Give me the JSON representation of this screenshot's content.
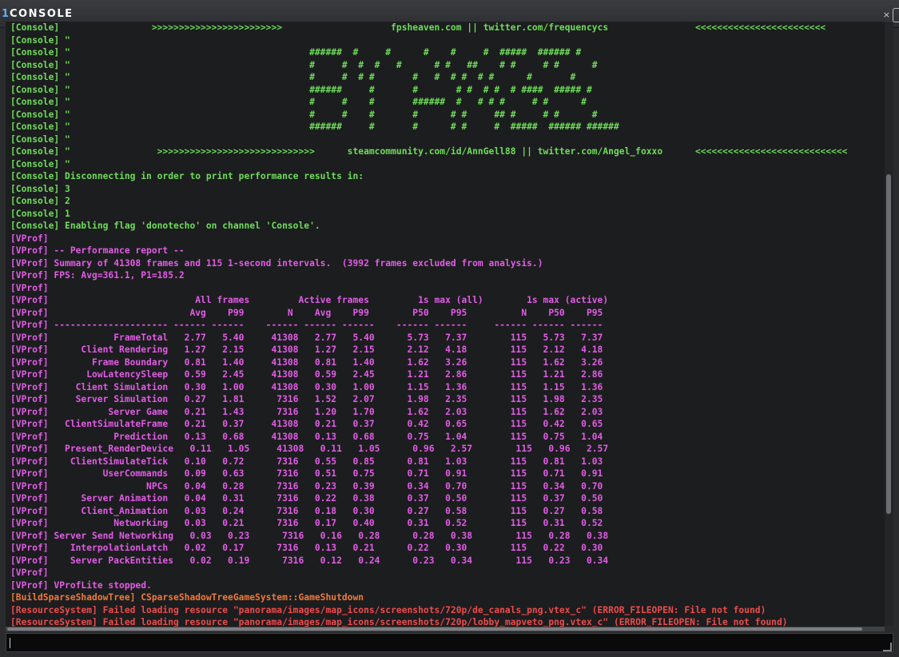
{
  "window": {
    "title_prefix": "1",
    "title": "CONSOLE",
    "close_glyph": "×"
  },
  "colors": {
    "console": "#6fdc5a",
    "vprof": "#e25ce6",
    "buildsparseshadowtree": "#ef7a3a",
    "resourcesystem": "#ee4b4b"
  },
  "log": [
    {
      "type": "console",
      "text": "[Console]                 >>>>>>>>>>>>>>>>>>>>>>>>                    fpsheaven.com || twitter.com/frequencycs                <<<<<<<<<<<<<<<<<<<<<<<<"
    },
    {
      "type": "console",
      "text": "[Console] \""
    },
    {
      "type": "console",
      "text": "[Console] \"                                            ######  #     #      #    #     #  #####  ###### #"
    },
    {
      "type": "console",
      "text": "[Console] \"                                            #     #  #  #   #      # #   ##    # #     # #      #"
    },
    {
      "type": "console",
      "text": "[Console] \"                                            #     #  # #       #   #  # #  # #      #       #"
    },
    {
      "type": "console",
      "text": "[Console] \"                                            ######     #       #       # #  # #  # ####  ##### #"
    },
    {
      "type": "console",
      "text": "[Console] \"                                            #     #    #       ######  #   # # #     # #      #"
    },
    {
      "type": "console",
      "text": "[Console] \"                                            #     #    #       #      # #     ## #     # #      #"
    },
    {
      "type": "console",
      "text": "[Console] \"                                            ######     #       #      # #     #  #####  ###### ######"
    },
    {
      "type": "console",
      "text": "[Console] \""
    },
    {
      "type": "console",
      "text": "[Console] \"                >>>>>>>>>>>>>>>>>>>>>>>>>>>>>      steamcommunity.com/id/AnnGell88 || twitter.com/Angel_foxxo      <<<<<<<<<<<<<<<<<<<<<<<<<<<<"
    },
    {
      "type": "console",
      "text": "[Console] \""
    },
    {
      "type": "console",
      "text": "[Console] Disconnecting in order to print performance results in:"
    },
    {
      "type": "console",
      "text": "[Console] 3"
    },
    {
      "type": "console",
      "text": "[Console] 2"
    },
    {
      "type": "console",
      "text": "[Console] 1"
    },
    {
      "type": "console",
      "text": "[Console] Enabling flag 'donotecho' on channel 'Console'."
    },
    {
      "type": "vprof",
      "text": "[VProf]"
    },
    {
      "type": "vprof",
      "text": "[VProf] -- Performance report --"
    },
    {
      "type": "vprof",
      "text": "[VProf] Summary of 41308 frames and 115 1-second intervals.  (3992 frames excluded from analysis.)"
    },
    {
      "type": "vprof",
      "text": "[VProf] FPS: Avg=361.1, P1=185.2"
    },
    {
      "type": "vprof",
      "text": "[VProf]"
    },
    {
      "type": "vprof",
      "text": "[VProf]                           All frames         Active frames         1s max (all)        1s max (active)"
    },
    {
      "type": "vprof",
      "text": "[VProf]                          Avg    P99        N    Avg    P99        P50    P95          N    P50    P95"
    },
    {
      "type": "vprof",
      "text": "[VProf] --------------------- ------ ------    ------ ------ ------    ------ ------     ------ ------ ------"
    },
    {
      "type": "vprof",
      "text": "[VProf]            FrameTotal   2.77   5.40     41308   2.77   5.40      5.73   7.37        115   5.73   7.37"
    },
    {
      "type": "vprof",
      "text": "[VProf]      Client Rendering   1.27   2.15     41308   1.27   2.15      2.12   4.18        115   2.12   4.18"
    },
    {
      "type": "vprof",
      "text": "[VProf]        Frame Boundary   0.81   1.40     41308   0.81   1.40      1.62   3.26        115   1.62   3.26"
    },
    {
      "type": "vprof",
      "text": "[VProf]       LowLatencySleep   0.59   2.45     41308   0.59   2.45      1.21   2.86        115   1.21   2.86"
    },
    {
      "type": "vprof",
      "text": "[VProf]     Client Simulation   0.30   1.00     41308   0.30   1.00      1.15   1.36        115   1.15   1.36"
    },
    {
      "type": "vprof",
      "text": "[VProf]     Server Simulation   0.27   1.81      7316   1.52   2.07      1.98   2.35        115   1.98   2.35"
    },
    {
      "type": "vprof",
      "text": "[VProf]           Server Game   0.21   1.43      7316   1.20   1.70      1.62   2.03        115   1.62   2.03"
    },
    {
      "type": "vprof",
      "text": "[VProf]   ClientSimulateFrame   0.21   0.37     41308   0.21   0.37      0.42   0.65        115   0.42   0.65"
    },
    {
      "type": "vprof",
      "text": "[VProf]            Prediction   0.13   0.68     41308   0.13   0.68      0.75   1.04        115   0.75   1.04"
    },
    {
      "type": "vprof",
      "text": "[VProf]   Present_RenderDevice   0.11   1.05     41308   0.11   1.05      0.96   2.57        115   0.96   2.57"
    },
    {
      "type": "vprof",
      "text": "[VProf]    ClientSimulateTick   0.10   0.72      7316   0.55   0.85      0.81   1.03        115   0.81   1.03"
    },
    {
      "type": "vprof",
      "text": "[VProf]          UserCommands   0.09   0.63      7316   0.51   0.75      0.71   0.91        115   0.71   0.91"
    },
    {
      "type": "vprof",
      "text": "[VProf]                  NPCs   0.04   0.28      7316   0.23   0.39      0.34   0.70        115   0.34   0.70"
    },
    {
      "type": "vprof",
      "text": "[VProf]      Server Animation   0.04   0.31      7316   0.22   0.38      0.37   0.50        115   0.37   0.50"
    },
    {
      "type": "vprof",
      "text": "[VProf]      Client_Animation   0.03   0.24      7316   0.18   0.30      0.27   0.58        115   0.27   0.58"
    },
    {
      "type": "vprof",
      "text": "[VProf]            Networking   0.03   0.21      7316   0.17   0.40      0.31   0.52        115   0.31   0.52"
    },
    {
      "type": "vprof",
      "text": "[VProf] Server Send Networking   0.03   0.23      7316   0.16   0.28      0.28   0.38        115   0.28   0.38"
    },
    {
      "type": "vprof",
      "text": "[VProf]    InterpolationLatch   0.02   0.17      7316   0.13   0.21      0.22   0.30        115   0.22   0.30"
    },
    {
      "type": "vprof",
      "text": "[VProf]    Server PackEntities   0.02   0.19      7316   0.12   0.24      0.23   0.34        115   0.23   0.34"
    },
    {
      "type": "vprof",
      "text": "[VProf]"
    },
    {
      "type": "vprof",
      "text": "[VProf] VProfLite stopped."
    },
    {
      "type": "build",
      "text": "[BuildSparseShadowTree] CSparseShadowTreeGameSystem::GameShutdown"
    },
    {
      "type": "resource",
      "text": "[ResourceSystem] Failed loading resource \"panorama/images/map_icons/screenshots/720p/de_canals_png.vtex_c\" (ERROR_FILEOPEN: File not found)"
    },
    {
      "type": "resource",
      "text": "[ResourceSystem] Failed loading resource \"panorama/images/map_icons/screenshots/720p/lobby_mapveto_png.vtex_c\" (ERROR_FILEOPEN: File not found)"
    }
  ],
  "input": {
    "value": ""
  }
}
